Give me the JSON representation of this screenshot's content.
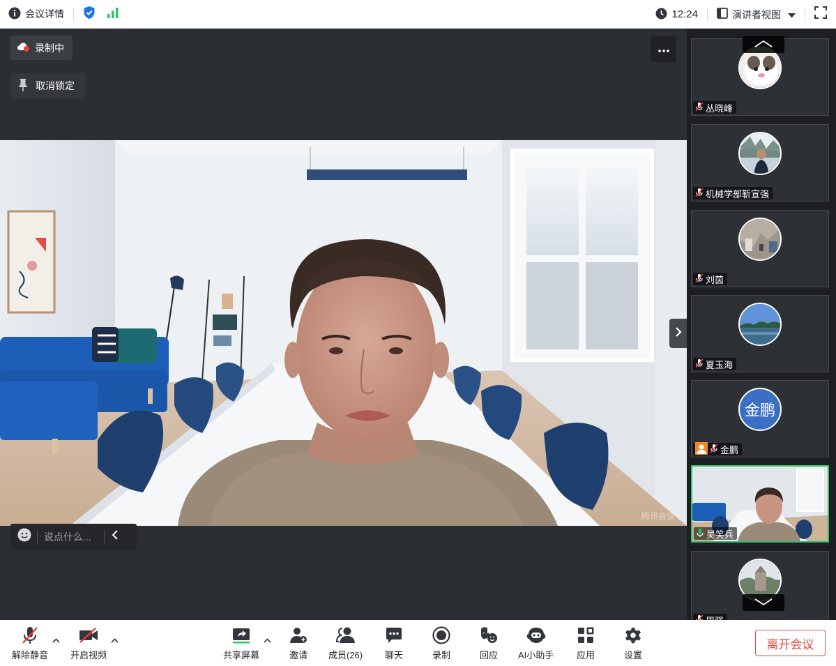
{
  "topbar": {
    "meeting_details": "会议详情",
    "time": "12:24",
    "view_mode": "演讲者视图"
  },
  "main": {
    "recording_label": "录制中",
    "unpin_label": "取消锁定",
    "chat_placeholder": "说点什么..."
  },
  "participants": [
    {
      "name": "丛晓峰"
    },
    {
      "name": "机械学部靳宣强"
    },
    {
      "name": "刘茵"
    },
    {
      "name": "夏玉海"
    },
    {
      "name": "金鹏",
      "avatar_text": "金鹏"
    },
    {
      "name": "吴笑兵"
    },
    {
      "name": "周强"
    }
  ],
  "toolbar": {
    "unmute": "解除静音",
    "start_video": "开启视频",
    "share_screen": "共享屏幕",
    "invite": "邀请",
    "members": "成员(26)",
    "chat": "聊天",
    "record": "录制",
    "reaction": "回应",
    "ai_assistant": "AI小助手",
    "apps": "应用",
    "settings": "设置",
    "leave": "离开会议"
  },
  "colors": {
    "accent_blue": "#1a73e8",
    "signal_green": "#2fc16a",
    "leave_red": "#e5473b",
    "active_speaker": "#2fc16a"
  }
}
